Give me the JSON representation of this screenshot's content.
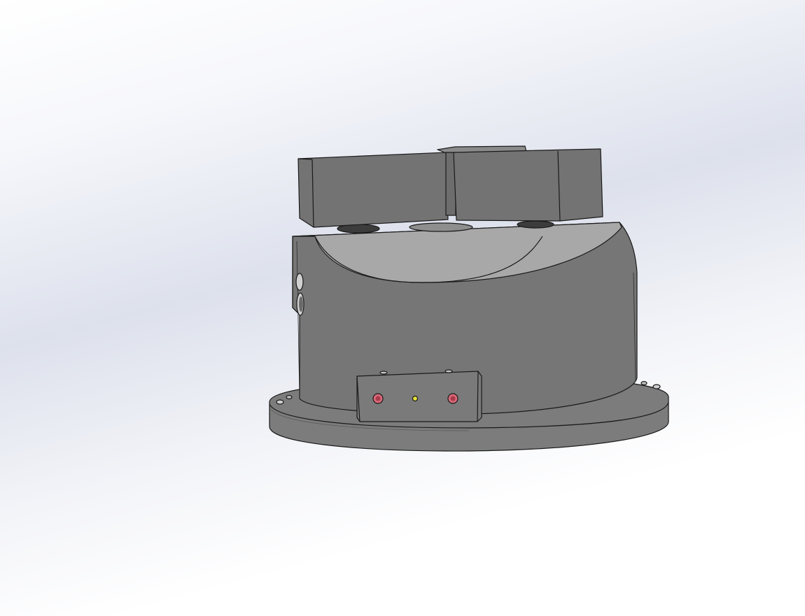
{
  "viewport": {
    "background_top": "#ffffff",
    "background_mid": "#dde1ec",
    "background_bottom": "#ffffff"
  },
  "model": {
    "body_color": "#767676",
    "top_face_color": "#a9a9a9",
    "jaw_color": "#737373",
    "flange_color": "#7c7c7c",
    "edge_color": "#1a1a1a",
    "port_color": "#d96a7a",
    "indicator_color": "#e8e23a",
    "connector_block_color": "#7a7a7a"
  }
}
